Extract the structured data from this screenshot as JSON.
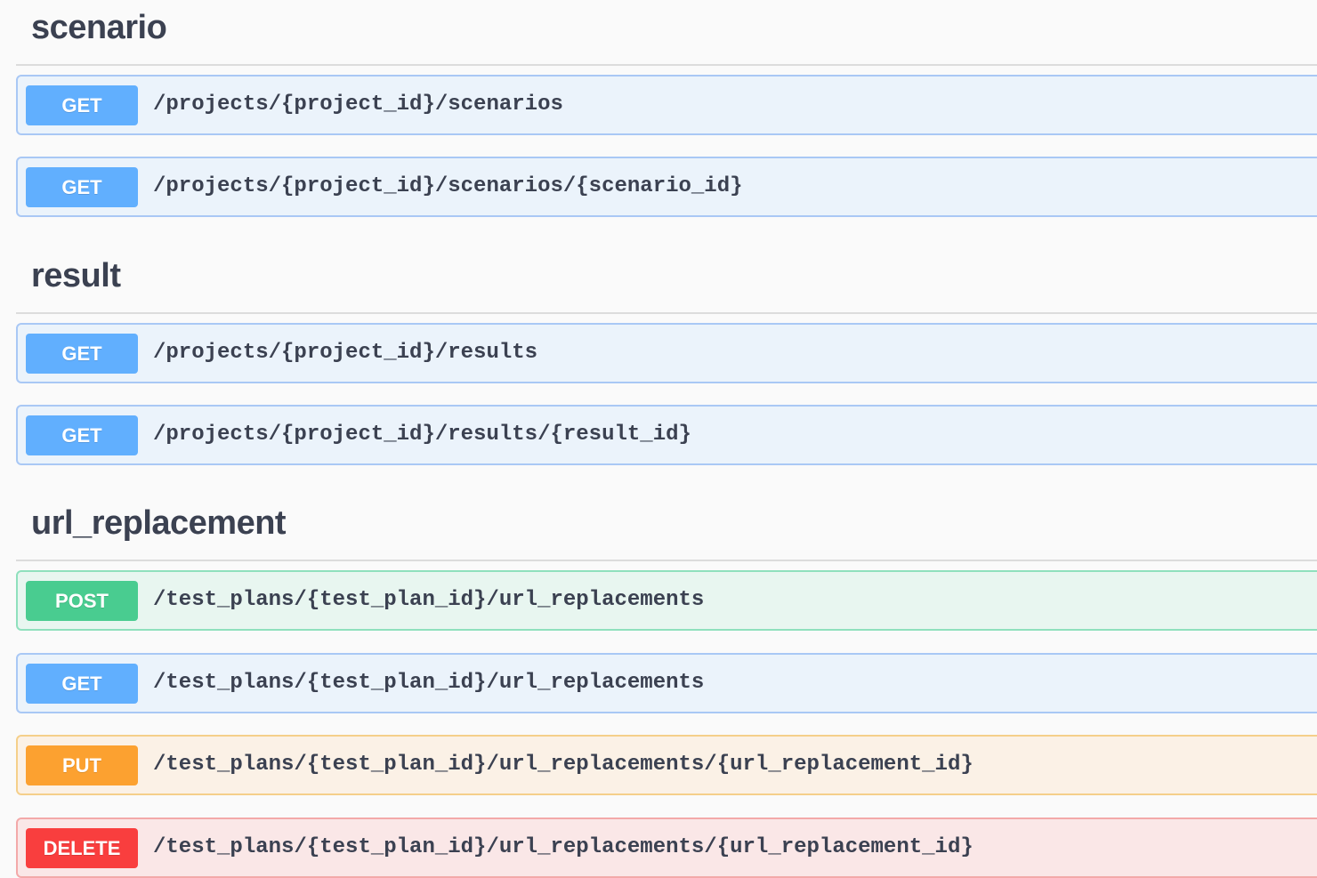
{
  "sections": [
    {
      "title": "scenario",
      "operations": [
        {
          "method": "GET",
          "path": "/projects/{project_id}/scenarios"
        },
        {
          "method": "GET",
          "path": "/projects/{project_id}/scenarios/{scenario_id}"
        }
      ]
    },
    {
      "title": "result",
      "operations": [
        {
          "method": "GET",
          "path": "/projects/{project_id}/results"
        },
        {
          "method": "GET",
          "path": "/projects/{project_id}/results/{result_id}"
        }
      ]
    },
    {
      "title": "url_replacement",
      "operations": [
        {
          "method": "POST",
          "path": "/test_plans/{test_plan_id}/url_replacements"
        },
        {
          "method": "GET",
          "path": "/test_plans/{test_plan_id}/url_replacements"
        },
        {
          "method": "PUT",
          "path": "/test_plans/{test_plan_id}/url_replacements/{url_replacement_id}"
        },
        {
          "method": "DELETE",
          "path": "/test_plans/{test_plan_id}/url_replacements/{url_replacement_id}"
        }
      ]
    }
  ],
  "colors": {
    "get": "#61affe",
    "post": "#49cc90",
    "put": "#fca130",
    "delete": "#f93e3e"
  }
}
